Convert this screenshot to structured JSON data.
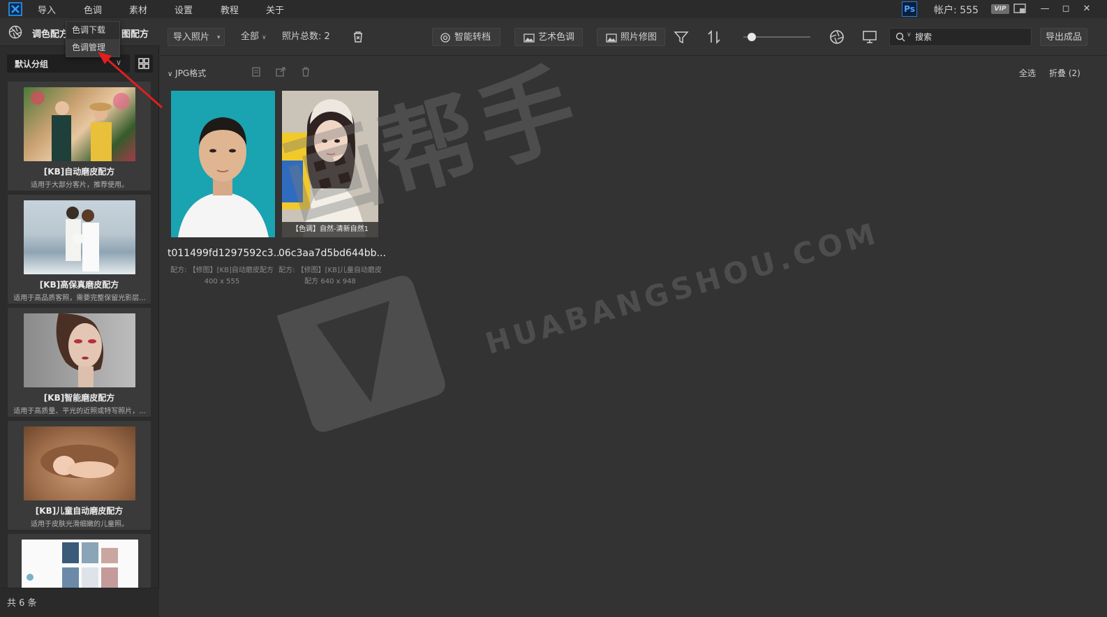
{
  "menubar": {
    "items": [
      "导入",
      "色调",
      "素材",
      "设置",
      "教程",
      "关于"
    ],
    "ps_label": "Ps",
    "account": "帐户: 555",
    "vip": "VIP"
  },
  "left_panel": {
    "tab_color": "调色配方",
    "tab_retouch": "图配方",
    "group": "默认分组",
    "recipes": [
      {
        "name": "[KB]自动磨皮配方",
        "desc": "适用于大部分客片，推荐使用。"
      },
      {
        "name": "[KB]高保真磨皮配方",
        "desc": "适用于高品质客照，需要完整保留光影层..."
      },
      {
        "name": "[KB]智能磨皮配方",
        "desc": "适用于高质量、平光的近照或特写照片，..."
      },
      {
        "name": "[KB]儿童自动磨皮配方",
        "desc": "适用于皮肤光滑细嫩的儿童照。"
      }
    ],
    "footer": "共 6 条"
  },
  "dropdown": {
    "items": [
      "色调下载",
      "色调管理"
    ]
  },
  "toolbar": {
    "import": "导入照片",
    "filter_all": "全部",
    "total": "照片总数:  2",
    "smart_convert": "智能转档",
    "art_tone": "艺术色调",
    "photo_retouch": "照片修图",
    "search_placeholder": "搜索",
    "export": "导出成品"
  },
  "content": {
    "section": "JPG格式",
    "select_all": "全选",
    "collapse": "折叠 (2)",
    "photos": [
      {
        "name": "t011499fd1297592c3...",
        "meta": "配方: 【修图】[KB]自动磨皮配方  400 x 555",
        "tag": ""
      },
      {
        "name": "06c3aa7d5bd644bb...",
        "meta": "配方: 【修图】[KB]儿童自动磨皮配方  640 x 948",
        "tag": "【色调】自然-清新自然1"
      }
    ]
  },
  "watermark": {
    "cn": "画帮手",
    "en": "HUABANGSHOU.COM"
  }
}
